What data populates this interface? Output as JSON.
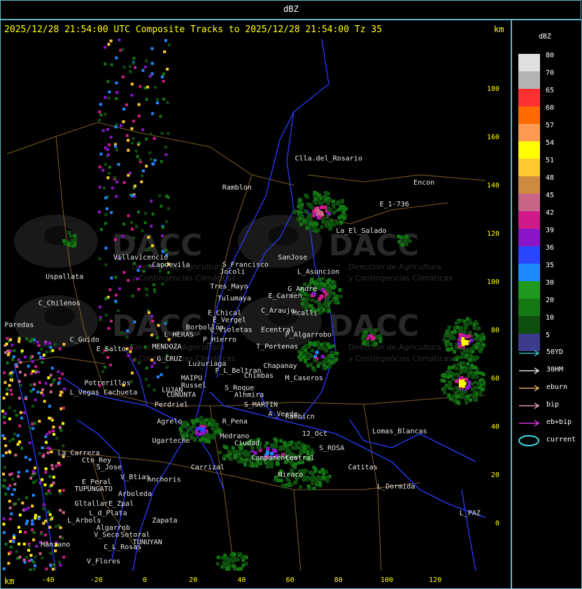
{
  "window_title": "dBZ",
  "header": {
    "text": "2025/12/28 21:54:00 UTC Composite Tracks to 2025/12/28 21:54:00 Tz 35",
    "km_top": "km",
    "km_bottom": "km"
  },
  "watermark": {
    "brand": "DACC",
    "line1": "Dirección de Agricultura",
    "line2": "y Contingencias Climáticas"
  },
  "axes": {
    "x_ticks": [
      "-40",
      "-20",
      "0",
      "20",
      "40",
      "60",
      "80",
      "100",
      "120"
    ],
    "y_ticks": [
      "180",
      "160",
      "140",
      "120",
      "100",
      "80",
      "60",
      "40",
      "20",
      "0"
    ]
  },
  "places": [
    {
      "name": "Clla.del_Rosario",
      "lon": 62,
      "lat": 150
    },
    {
      "name": "Encon",
      "lon": 111,
      "lat": 140
    },
    {
      "name": "E_1-736",
      "lon": 97,
      "lat": 131
    },
    {
      "name": "Ramblon",
      "lon": 32,
      "lat": 138
    },
    {
      "name": "La_El_Salado",
      "lon": 79,
      "lat": 120
    },
    {
      "name": "SanJose",
      "lon": 55,
      "lat": 109
    },
    {
      "name": "S_Francisco",
      "lon": 32,
      "lat": 106
    },
    {
      "name": "L_Asuncion",
      "lon": 63,
      "lat": 103
    },
    {
      "name": "Jocoli",
      "lon": 31,
      "lat": 103
    },
    {
      "name": "Tres_Mayo",
      "lon": 27,
      "lat": 97
    },
    {
      "name": "G_Andre",
      "lon": 59,
      "lat": 96
    },
    {
      "name": "E_Carmen",
      "lon": 51,
      "lat": 93
    },
    {
      "name": "Tulumaya",
      "lon": 30,
      "lat": 92
    },
    {
      "name": "C_Araujo",
      "lon": 48,
      "lat": 87
    },
    {
      "name": "E_Chical",
      "lon": 26,
      "lat": 86
    },
    {
      "name": "E_Vergel",
      "lon": 28,
      "lat": 83
    },
    {
      "name": "Mcalli",
      "lon": 61,
      "lat": 86
    },
    {
      "name": "Ecentral",
      "lon": 48,
      "lat": 79
    },
    {
      "name": "P_Algarrobo",
      "lon": 58,
      "lat": 77
    },
    {
      "name": "Borbollon",
      "lon": 17,
      "lat": 80
    },
    {
      "name": "L_Violetas",
      "lon": 27,
      "lat": 79
    },
    {
      "name": "L_HERAS",
      "lon": 8,
      "lat": 77
    },
    {
      "name": "P_Hierro",
      "lon": 24,
      "lat": 75
    },
    {
      "name": "T_Portenas",
      "lon": 46,
      "lat": 72
    },
    {
      "name": "MENDOZA",
      "lon": 3,
      "lat": 72
    },
    {
      "name": "G_CRUZ",
      "lon": 5,
      "lat": 67
    },
    {
      "name": "Luzuriaga",
      "lon": 18,
      "lat": 65
    },
    {
      "name": "Chapanay",
      "lon": 49,
      "lat": 64
    },
    {
      "name": "F_L_Beltran",
      "lon": 29,
      "lat": 62
    },
    {
      "name": "MAIPU",
      "lon": 15,
      "lat": 59
    },
    {
      "name": "Chimbas",
      "lon": 41,
      "lat": 60
    },
    {
      "name": "M_Caseros",
      "lon": 58,
      "lat": 59
    },
    {
      "name": "Russel",
      "lon": 15,
      "lat": 56
    },
    {
      "name": "S_Roque",
      "lon": 33,
      "lat": 55
    },
    {
      "name": "LUJAN",
      "lon": 7,
      "lat": 54
    },
    {
      "name": "Alhmira",
      "lon": 37,
      "lat": 52
    },
    {
      "name": "CUNUNTA",
      "lon": 9,
      "lat": 52
    },
    {
      "name": "Perdriel",
      "lon": 4,
      "lat": 48
    },
    {
      "name": "S_MARTIN",
      "lon": 41,
      "lat": 48
    },
    {
      "name": "A_Verde",
      "lon": 51,
      "lat": 44
    },
    {
      "name": "Rambicn",
      "lon": 58,
      "lat": 43
    },
    {
      "name": "Agrelo",
      "lon": 5,
      "lat": 41
    },
    {
      "name": "R_Pena",
      "lon": 32,
      "lat": 41
    },
    {
      "name": "Lomas_Blancas",
      "lon": 94,
      "lat": 37
    },
    {
      "name": "Medrano",
      "lon": 31,
      "lat": 35
    },
    {
      "name": "12_Oct",
      "lon": 65,
      "lat": 36
    },
    {
      "name": "Ugarteche",
      "lon": 3,
      "lat": 33
    },
    {
      "name": "Ciudad",
      "lon": 37,
      "lat": 32
    },
    {
      "name": "S_ROSA",
      "lon": 72,
      "lat": 30
    },
    {
      "name": "Central",
      "lon": 58,
      "lat": 26
    },
    {
      "name": "Campamentos",
      "lon": 44,
      "lat": 26
    },
    {
      "name": "Carrizal",
      "lon": 19,
      "lat": 22
    },
    {
      "name": "Catitas",
      "lon": 84,
      "lat": 22
    },
    {
      "name": "Miraco",
      "lon": 55,
      "lat": 19
    },
    {
      "name": "Anchoris",
      "lon": 1,
      "lat": 17
    },
    {
      "name": "L_Dormida",
      "lon": 96,
      "lat": 14
    },
    {
      "name": "L_PAZ",
      "lon": 130,
      "lat": 3
    },
    {
      "name": "Uspallata",
      "lon": -41,
      "lat": 101
    },
    {
      "name": "Villavicencio",
      "lon": -13,
      "lat": 109
    },
    {
      "name": "Capdevila",
      "lon": 3,
      "lat": 106
    },
    {
      "name": "C_Chilenos",
      "lon": -44,
      "lat": 90
    },
    {
      "name": "Paredas",
      "lon": -58,
      "lat": 81
    },
    {
      "name": "C_Guido",
      "lon": -31,
      "lat": 75
    },
    {
      "name": "E_Salto",
      "lon": -20,
      "lat": 71
    },
    {
      "name": "Potrerillos",
      "lon": -25,
      "lat": 57
    },
    {
      "name": "L_Vegas",
      "lon": -31,
      "lat": 53
    },
    {
      "name": "Cachueta",
      "lon": -17,
      "lat": 53
    },
    {
      "name": "La_Carrera",
      "lon": -36,
      "lat": 28
    },
    {
      "name": "Cto_Rey",
      "lon": -26,
      "lat": 25
    },
    {
      "name": "S_Jose",
      "lon": -20,
      "lat": 22
    },
    {
      "name": "V_Btias",
      "lon": -10,
      "lat": 18
    },
    {
      "name": "E_Peral",
      "lon": -26,
      "lat": 16
    },
    {
      "name": "TUPUNGATO",
      "lon": -29,
      "lat": 13
    },
    {
      "name": "Arboleda",
      "lon": -11,
      "lat": 11
    },
    {
      "name": "Gltallar",
      "lon": -29,
      "lat": 7
    },
    {
      "name": "E_Zpal",
      "lon": -15,
      "lat": 7
    },
    {
      "name": "L_d_Plata",
      "lon": -23,
      "lat": 3
    },
    {
      "name": "L_Arbols",
      "lon": -32,
      "lat": 0
    },
    {
      "name": "Zapata",
      "lon": 3,
      "lat": 0
    },
    {
      "name": "Algarrob",
      "lon": -20,
      "lat": -3
    },
    {
      "name": "V_Seco",
      "lon": -21,
      "lat": -6
    },
    {
      "name": "Sotoral",
      "lon": -10,
      "lat": -6
    },
    {
      "name": "TUNUYAN",
      "lon": -5,
      "lat": -9
    },
    {
      "name": "Manzano",
      "lon": -43,
      "lat": -10
    },
    {
      "name": "C_L_Rosas",
      "lon": -17,
      "lat": -11
    },
    {
      "name": "V_Flores",
      "lon": -24,
      "lat": -17
    }
  ],
  "legend": {
    "unit": "dBZ",
    "scale": [
      {
        "label": "80",
        "color": "#e0e0e0"
      },
      {
        "label": "70",
        "color": "#b4b4b4"
      },
      {
        "label": "65",
        "color": "#ff3030"
      },
      {
        "label": "60",
        "color": "#ff6a00"
      },
      {
        "label": "57",
        "color": "#ff9a50"
      },
      {
        "label": "54",
        "color": "#ffff00"
      },
      {
        "label": "51",
        "color": "#ffc830"
      },
      {
        "label": "48",
        "color": "#d08a40"
      },
      {
        "label": "45",
        "color": "#c86488"
      },
      {
        "label": "42",
        "color": "#d01a8a"
      },
      {
        "label": "39",
        "color": "#8a14c8"
      },
      {
        "label": "36",
        "color": "#2a46ff"
      },
      {
        "label": "35",
        "color": "#1e8aff"
      },
      {
        "label": "30",
        "color": "#1e9a1e"
      },
      {
        "label": "20",
        "color": "#137813"
      },
      {
        "label": "10",
        "color": "#0e4e0e"
      },
      {
        "label": "5",
        "color": "#3c3c8c"
      }
    ],
    "tracks": [
      {
        "label": "50YD",
        "color": "#40d8e0",
        "kind": "arrow"
      },
      {
        "label": "30HM",
        "color": "#ffffff",
        "kind": "arrow"
      },
      {
        "label": "eburn",
        "color": "#ffc46a",
        "kind": "arrow"
      },
      {
        "label": "bip",
        "color": "#ffb4c8",
        "kind": "arrow"
      },
      {
        "label": "eb+bip",
        "color": "#ff40ff",
        "kind": "arrow"
      },
      {
        "label": "current",
        "color": "#40d8e0",
        "kind": "ellipse"
      }
    ]
  },
  "colors": {
    "frame": "#5fb7c7",
    "border_lines": "#2a3cff",
    "province_lines": "#8a6a2a",
    "axis_text": "#ffff00"
  }
}
